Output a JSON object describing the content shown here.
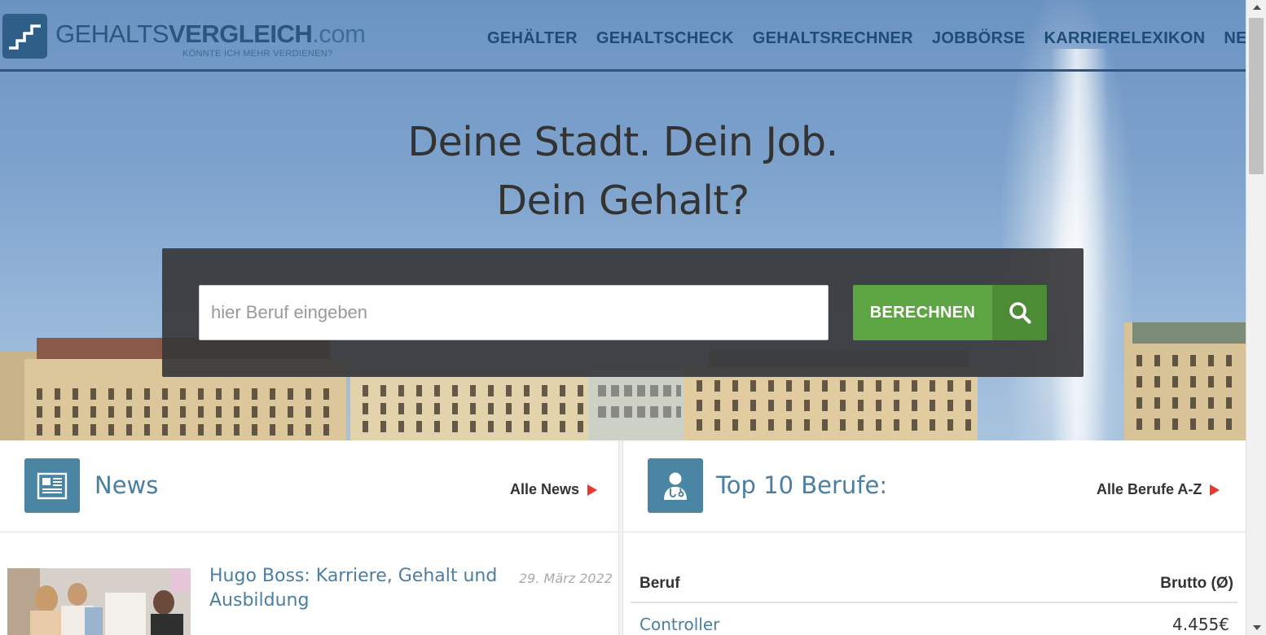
{
  "logo": {
    "brand_light": "GEHALTS",
    "brand_bold": "VERGLEICH",
    "brand_tld": ".com",
    "tagline": "KÖNNTE ICH MEHR VERDIENEN?"
  },
  "nav": {
    "items": [
      "GEHÄLTER",
      "GEHALTSCHECK",
      "GEHALTSRECHNER",
      "JOBBÖRSE",
      "KARRIERELEXIKON",
      "NEWS"
    ]
  },
  "hero": {
    "line1": "Deine Stadt. Dein Job.",
    "line2": "Dein Gehalt?"
  },
  "search": {
    "placeholder": "hier Beruf eingeben",
    "button_label": "BERECHNEN",
    "button_icon": "search-icon"
  },
  "news": {
    "title": "News",
    "icon": "newspaper-icon",
    "all_link": "Alle News",
    "items": [
      {
        "title": "Hugo Boss: Karriere, Gehalt und Ausbildung",
        "date": "29. März 2022"
      }
    ]
  },
  "top_jobs": {
    "title": "Top 10 Berufe:",
    "icon": "doctor-icon",
    "all_link": "Alle Berufe A-Z",
    "col_job": "Beruf",
    "col_salary": "Brutto (Ø)",
    "rows": [
      {
        "job": "Controller",
        "salary": "4.455€"
      }
    ]
  },
  "colors": {
    "nav_text": "#1e4c79",
    "button_green": "#5da443",
    "icon_blue": "#4a86a4",
    "accent_red": "#e8382f"
  }
}
